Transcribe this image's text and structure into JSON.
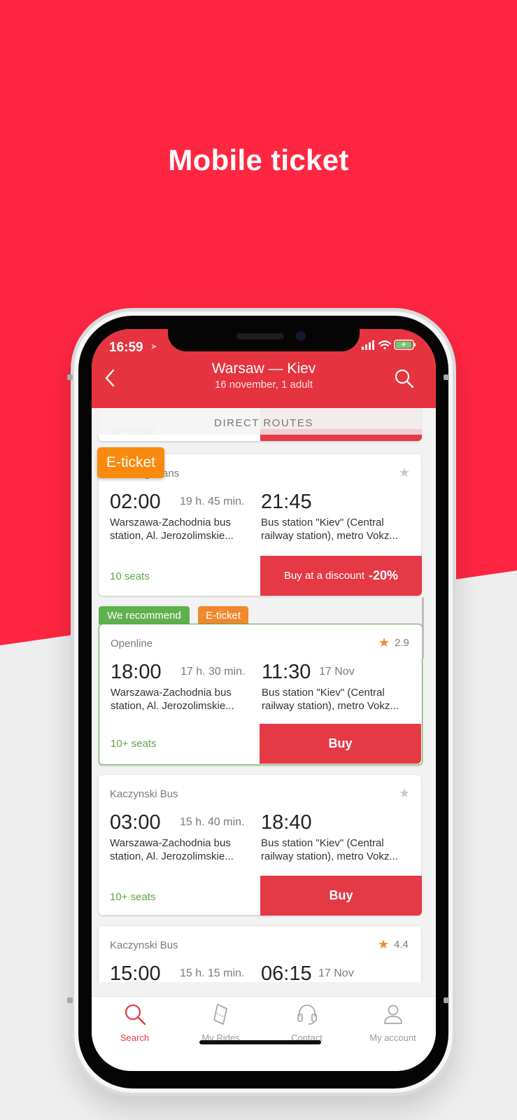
{
  "headline": "Mobile ticket",
  "status_bar": {
    "time": "16:59"
  },
  "header": {
    "title": "Warsaw — Kiev",
    "subtitle": "16 november, 1 adult"
  },
  "section_label": "DIRECT ROUTES",
  "partial_top": {
    "seats": "10+ seats"
  },
  "cards": [
    {
      "badge": "E-ticket",
      "operator": "Mustang Trans",
      "dep_time": "02:00",
      "duration": "19 h. 45 min.",
      "arr_time": "21:45",
      "arr_date": "",
      "from": "Warszawa-Zachodnia bus station, Al. Jerozolimskie...",
      "to": "Bus station \"Kiev\" (Central railway station), metro Vokz...",
      "seats": "10 seats",
      "buy_label": "Buy at a discount",
      "discount": "-20%"
    },
    {
      "badges": [
        "We recommend",
        "E-ticket"
      ],
      "operator": "Openline",
      "rating": "2.9",
      "dep_time": "18:00",
      "duration": "17 h. 30 min.",
      "arr_time": "11:30",
      "arr_date": "17 Nov",
      "from": "Warszawa-Zachodnia bus station, Al. Jerozolimskie...",
      "to": "Bus station \"Kiev\" (Central railway station), metro Vokz...",
      "seats": "10+ seats",
      "buy_label": "Buy"
    },
    {
      "operator": "Kaczynski Bus",
      "dep_time": "03:00",
      "duration": "15 h. 40 min.",
      "arr_time": "18:40",
      "from": "Warszawa-Zachodnia bus station, Al. Jerozolimskie...",
      "to": "Bus station \"Kiev\" (Central railway station), metro Vokz...",
      "seats": "10+ seats",
      "buy_label": "Buy"
    },
    {
      "operator": "Kaczynski Bus",
      "rating": "4.4",
      "dep_time": "15:00",
      "duration": "15 h. 15 min.",
      "arr_time": "06:15",
      "arr_date": "17 Nov"
    }
  ],
  "tabs": [
    {
      "label": "Search",
      "icon": "search-icon"
    },
    {
      "label": "My Rides",
      "icon": "ticket-icon"
    },
    {
      "label": "Contact",
      "icon": "headset-icon"
    },
    {
      "label": "My account",
      "icon": "person-icon"
    }
  ],
  "colors": {
    "brand_red": "#FF2641",
    "app_red": "#E5343F",
    "recommend_green": "#5FB14D",
    "eticket_orange": "#F98A0E",
    "star_orange": "#F0892D"
  }
}
